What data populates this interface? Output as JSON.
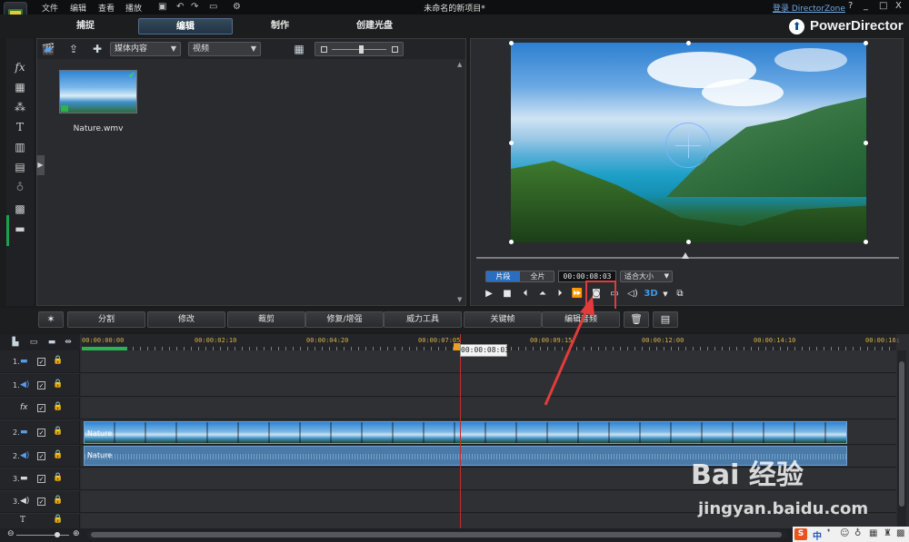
{
  "menu": [
    "文件",
    "编辑",
    "查看",
    "播放"
  ],
  "window": {
    "title": "未命名的新项目*",
    "directorzone_link": "登录 DirectorZone",
    "help": "?",
    "minimize": "_",
    "maximize": "□",
    "close": "X"
  },
  "modes": {
    "tabs": [
      "捕捉",
      "编辑",
      "制作",
      "创建光盘"
    ],
    "active": "编辑"
  },
  "brand": "PowerDirector",
  "library": {
    "content_combo": "媒体内容",
    "filter_combo": "视频",
    "items": [
      {
        "name": "Nature.wmv"
      }
    ]
  },
  "preview": {
    "mode_clip": "片段",
    "mode_movie": "全片",
    "timecode": "00:00:08:03",
    "fit": "适合大小",
    "three_d": "3D"
  },
  "edit_tools": {
    "split": "分割",
    "modify": "修改",
    "crop": "裁剪",
    "fix_enhance": "修复/增强",
    "power_tools": "威力工具",
    "keyframe": "关键帧",
    "edit_audio": "编辑音频"
  },
  "timeline": {
    "ruler_ticks": [
      "00:00:00:00",
      "00:00:02:10",
      "00:00:04:20",
      "00:00:07:05",
      "00:00:09:15",
      "00:00:12:00",
      "00:00:14:10",
      "00:00:16:"
    ],
    "playhead_time": "00:00:08:03",
    "tracks": [
      {
        "num": "1.",
        "kind": "video"
      },
      {
        "num": "1.",
        "kind": "audio"
      },
      {
        "num": "",
        "kind": "fx",
        "label": "fx"
      },
      {
        "num": "2.",
        "kind": "video"
      },
      {
        "num": "2.",
        "kind": "audio"
      },
      {
        "num": "3.",
        "kind": "video"
      },
      {
        "num": "3.",
        "kind": "audio"
      },
      {
        "num": "",
        "kind": "title",
        "label": "T"
      }
    ],
    "clips": {
      "video": "Nature",
      "audio": "Nature"
    }
  },
  "watermark": {
    "logo": "Bai 经验",
    "url": "jingyan.baidu.com"
  },
  "ime": {
    "s": "S",
    "lang": "中"
  },
  "colors": {
    "accent": "#2a6fbf",
    "green": "#19a24a",
    "highlight": "#e03c3c",
    "playhead": "#c0302a"
  }
}
